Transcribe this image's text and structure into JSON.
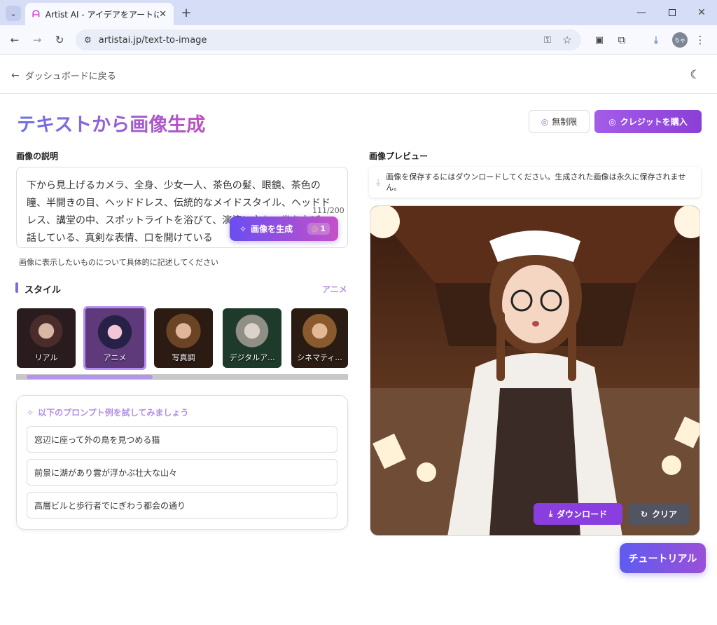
{
  "browser": {
    "tab_title": "Artist AI - アイデアをアートに変換",
    "url": "artistai.jp/text-to-image",
    "profile_initials": "ちゃ"
  },
  "header": {
    "back_label": "ダッシュボードに戻る"
  },
  "page": {
    "title": "テキストから画像生成",
    "unlimited_label": "無制限",
    "buy_credits_label": "クレジットを購入"
  },
  "description": {
    "label": "画像の説明",
    "text": "下から見上げるカメラ、全身、少女一人、茶色の髪、眼鏡、茶色の瞳、半開きの目、ヘッドドレス、伝統的なメイドスタイル、ヘッドドレス、講堂の中、スポットライトを浴びて、演壇に立ち、拳を上げ、話している、真剣な表情、口を開けている",
    "counter": "111/200",
    "hint": "画像に表示したいものについて具体的に記述してください",
    "generate_label": "画像を生成",
    "generate_cost": "1"
  },
  "style": {
    "label": "スタイル",
    "current": "アニメ",
    "options": [
      {
        "label": "リアル"
      },
      {
        "label": "アニメ"
      },
      {
        "label": "写真調"
      },
      {
        "label": "デジタルア..."
      },
      {
        "label": "シネマティ..."
      }
    ]
  },
  "prompts": {
    "heading": "以下のプロンプト例を試してみましょう",
    "items": [
      "窓辺に座って外の鳥を見つめる猫",
      "前景に湖があり雲が浮かぶ壮大な山々",
      "高層ビルと歩行者でにぎわう都会の通り"
    ]
  },
  "preview": {
    "label": "画像プレビュー",
    "notice": "画像を保存するにはダウンロードしてください。生成された画像は永久に保存されません。",
    "download_label": "ダウンロード",
    "clear_label": "クリア"
  },
  "tutorial_label": "チュートリアル",
  "colors": {
    "accent": "#8a3ee0",
    "accent_light": "#b38fe4",
    "title_gradient_start": "#6b73e6",
    "title_gradient_end": "#c04ec0"
  }
}
